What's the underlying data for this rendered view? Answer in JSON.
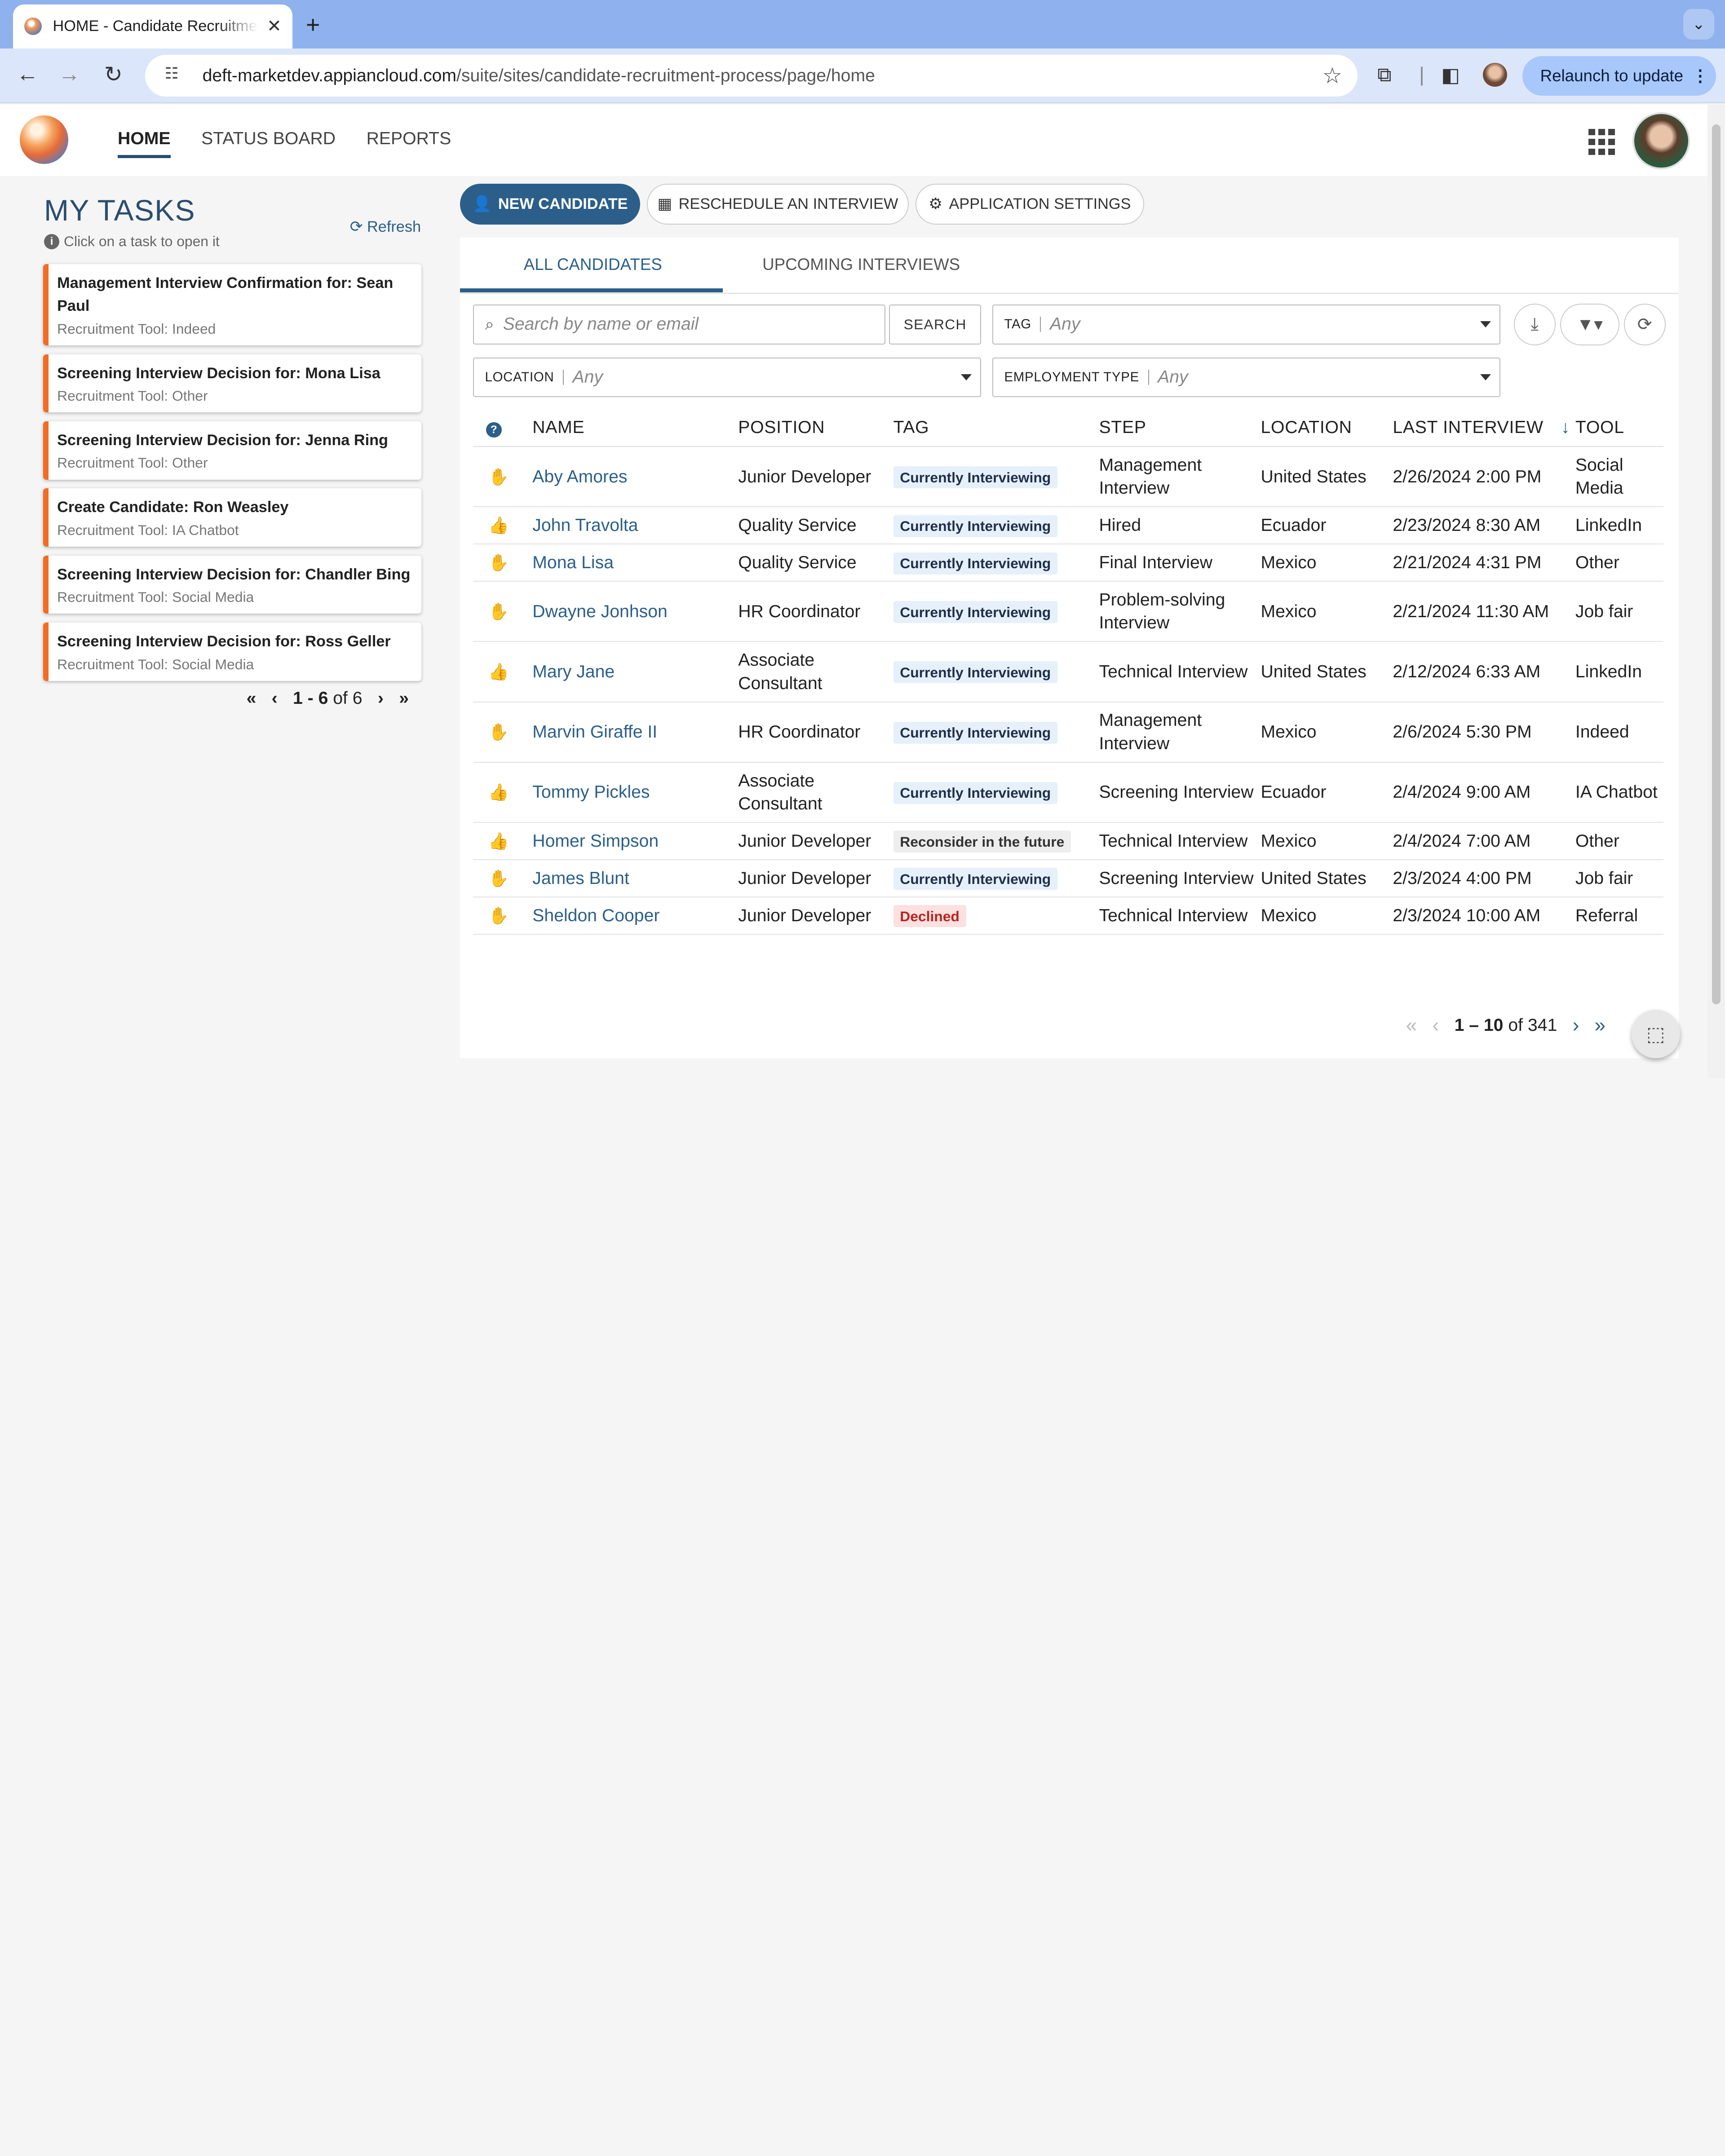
{
  "browser": {
    "tab_title": "HOME - Candidate Recruitment Process",
    "url_host": "deft-marketdev.appiancloud.com",
    "url_path": "/suite/sites/candidate-recruitment-process/page/home",
    "relaunch_label": "Relaunch to update"
  },
  "app": {
    "nav": [
      "HOME",
      "STATUS BOARD",
      "REPORTS"
    ],
    "active_nav": "HOME"
  },
  "tasks": {
    "title": "MY TASKS",
    "hint": "Click on a task to open it",
    "refresh_label": "Refresh",
    "items": [
      {
        "title": "Management Interview Confirmation for: Sean Paul",
        "subtitle": "Recruitment Tool: Indeed"
      },
      {
        "title": "Screening Interview Decision for: Mona Lisa",
        "subtitle": "Recruitment Tool: Other"
      },
      {
        "title": "Screening Interview Decision for: Jenna Ring",
        "subtitle": "Recruitment Tool: Other"
      },
      {
        "title": "Create Candidate: Ron Weasley",
        "subtitle": "Recruitment Tool: IA Chatbot"
      },
      {
        "title": "Screening Interview Decision for: Chandler Bing",
        "subtitle": "Recruitment Tool: Social Media"
      },
      {
        "title": "Screening Interview Decision for: Ross Geller",
        "subtitle": "Recruitment Tool: Social Media"
      }
    ],
    "pager": {
      "range": "1 - 6",
      "of": "of 6"
    }
  },
  "actions": {
    "new_candidate": "NEW CANDIDATE",
    "reschedule": "RESCHEDULE AN INTERVIEW",
    "settings": "APPLICATION SETTINGS"
  },
  "main_tabs": [
    "ALL CANDIDATES",
    "UPCOMING INTERVIEWS"
  ],
  "filters": {
    "search_placeholder": "Search by name or email",
    "search_button": "SEARCH",
    "tag_label": "TAG",
    "tag_value": "Any",
    "location_label": "LOCATION",
    "location_value": "Any",
    "employment_label": "EMPLOYMENT TYPE",
    "employment_value": "Any"
  },
  "table": {
    "headers": [
      "NAME",
      "POSITION",
      "TAG",
      "STEP",
      "LOCATION",
      "LAST INTERVIEW",
      "TOOL"
    ],
    "rows": [
      {
        "status": "hand",
        "name": "Aby Amores",
        "position": "Junior Developer",
        "tag": "Currently Interviewing",
        "tag_style": "blue",
        "step": "Management Interview",
        "location": "United States",
        "last_interview": "2/26/2024 2:00 PM",
        "tool": "Social Media"
      },
      {
        "status": "thumb",
        "name": "John Travolta",
        "position": "Quality Service",
        "tag": "Currently Interviewing",
        "tag_style": "blue",
        "step": "Hired",
        "location": "Ecuador",
        "last_interview": "2/23/2024 8:30 AM",
        "tool": "LinkedIn"
      },
      {
        "status": "hand",
        "name": "Mona Lisa",
        "position": "Quality Service",
        "tag": "Currently Interviewing",
        "tag_style": "blue",
        "step": "Final Interview",
        "location": "Mexico",
        "last_interview": "2/21/2024 4:31 PM",
        "tool": "Other"
      },
      {
        "status": "hand",
        "name": "Dwayne Jonhson",
        "position": "HR Coordinator",
        "tag": "Currently Interviewing",
        "tag_style": "blue",
        "step": "Problem-solving Interview",
        "location": "Mexico",
        "last_interview": "2/21/2024 11:30 AM",
        "tool": "Job fair"
      },
      {
        "status": "thumb",
        "name": "Mary Jane",
        "position": "Associate Consultant",
        "tag": "Currently Interviewing",
        "tag_style": "blue",
        "step": "Technical Interview",
        "location": "United States",
        "last_interview": "2/12/2024 6:33 AM",
        "tool": "LinkedIn"
      },
      {
        "status": "hand",
        "name": "Marvin Giraffe II",
        "position": "HR Coordinator",
        "tag": "Currently Interviewing",
        "tag_style": "blue",
        "step": "Management Interview",
        "location": "Mexico",
        "last_interview": "2/6/2024 5:30 PM",
        "tool": "Indeed"
      },
      {
        "status": "thumb",
        "name": "Tommy Pickles",
        "position": "Associate Consultant",
        "tag": "Currently Interviewing",
        "tag_style": "blue",
        "step": "Screening Interview",
        "location": "Ecuador",
        "last_interview": "2/4/2024 9:00 AM",
        "tool": "IA Chatbot"
      },
      {
        "status": "thumb",
        "name": "Homer Simpson",
        "position": "Junior Developer",
        "tag": "Reconsider in the future",
        "tag_style": "gray",
        "step": "Technical Interview",
        "location": "Mexico",
        "last_interview": "2/4/2024 7:00 AM",
        "tool": "Other"
      },
      {
        "status": "hand",
        "name": "James Blunt",
        "position": "Junior Developer",
        "tag": "Currently Interviewing",
        "tag_style": "blue",
        "step": "Screening Interview",
        "location": "United States",
        "last_interview": "2/3/2024 4:00 PM",
        "tool": "Job fair"
      },
      {
        "status": "hand",
        "name": "Sheldon Cooper",
        "position": "Junior Developer",
        "tag": "Declined",
        "tag_style": "red",
        "step": "Technical Interview",
        "location": "Mexico",
        "last_interview": "2/3/2024 10:00 AM",
        "tool": "Referral"
      }
    ]
  },
  "pager": {
    "range": "1 – 10",
    "of": "of 341"
  }
}
